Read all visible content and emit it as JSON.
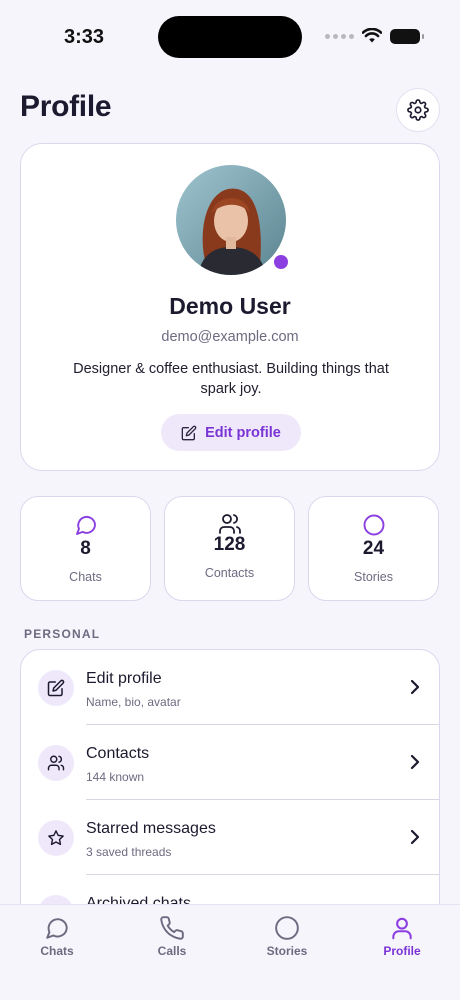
{
  "status_bar": {
    "time": "3:33"
  },
  "header": {
    "title": "Profile",
    "settings_icon": "gear-icon"
  },
  "profile": {
    "name": "Demo User",
    "email": "demo@example.com",
    "bio": "Designer & coffee enthusiast. Building things that spark joy.",
    "edit_button_label": "Edit profile",
    "online_status_color": "#8b3fe0"
  },
  "stats": [
    {
      "value": "8",
      "label": "Chats",
      "icon": "chat-bubble-icon"
    },
    {
      "value": "128",
      "label": "Contacts",
      "icon": "users-icon"
    },
    {
      "value": "24",
      "label": "Stories",
      "icon": "circle-icon"
    }
  ],
  "section": {
    "label": "PERSONAL",
    "items": [
      {
        "title": "Edit profile",
        "subtitle": "Name, bio, avatar",
        "icon": "edit-icon"
      },
      {
        "title": "Contacts",
        "subtitle": "144 known",
        "icon": "users-icon"
      },
      {
        "title": "Starred messages",
        "subtitle": "3 saved threads",
        "icon": "star-icon"
      },
      {
        "title": "Archived chats",
        "subtitle": "",
        "icon": "archive-icon"
      }
    ]
  },
  "tab_bar": {
    "tabs": [
      {
        "label": "Chats",
        "icon": "chat-bubble-icon",
        "active": false
      },
      {
        "label": "Calls",
        "icon": "phone-icon",
        "active": false
      },
      {
        "label": "Stories",
        "icon": "circle-icon",
        "active": false
      },
      {
        "label": "Profile",
        "icon": "person-icon",
        "active": true
      }
    ]
  },
  "colors": {
    "accent": "#7a34d6",
    "accent_soft": "#efe8fb",
    "background": "#f7f5fc"
  }
}
